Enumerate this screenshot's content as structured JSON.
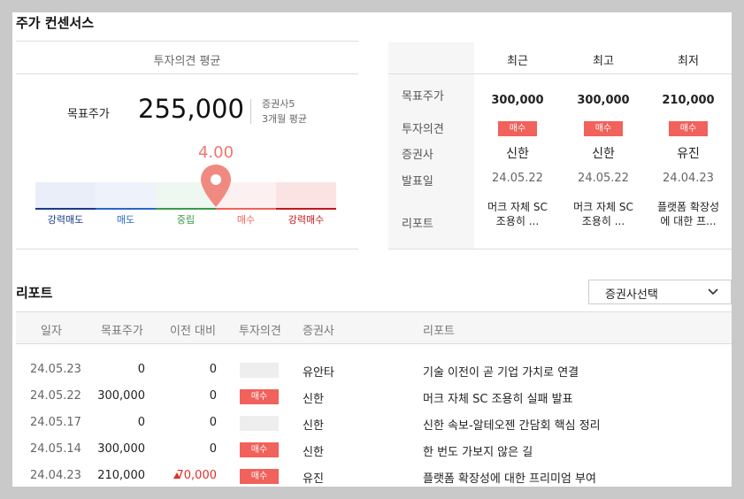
{
  "section_title": "주가 컨센서스",
  "consensus": {
    "header": "투자의견 평균",
    "target_label": "목표주가",
    "target_value": "255,000",
    "brokers_count": "증권사5",
    "period": "3개월 평균",
    "score": "4.00",
    "score_value": 4.0,
    "scale": [
      {
        "label": "강력매도",
        "color": "#1d3a8a",
        "bg": "#e9eef8"
      },
      {
        "label": "매도",
        "color": "#2a66c9",
        "bg": "#eef3fb"
      },
      {
        "label": "중립",
        "color": "#3a9a4a",
        "bg": "#eef7f0"
      },
      {
        "label": "매수",
        "color": "#f0625b",
        "bg": "#fdf0f0"
      },
      {
        "label": "강력매수",
        "color": "#c0191f",
        "bg": "#fbe3e4"
      }
    ],
    "pin_color": "#f08a80"
  },
  "compare": {
    "columns": [
      "최근",
      "최고",
      "최저"
    ],
    "row_labels": [
      "목표주가",
      "투자의견",
      "증권사",
      "발표일",
      "리포트"
    ],
    "data": [
      {
        "target": "300,000",
        "opinion": "매수",
        "broker": "신한",
        "date": "24.05.22",
        "report": [
          "머크 자체 SC",
          "조용히 ..."
        ]
      },
      {
        "target": "300,000",
        "opinion": "매수",
        "broker": "신한",
        "date": "24.05.22",
        "report": [
          "머크 자체 SC",
          "조용히 ..."
        ]
      },
      {
        "target": "210,000",
        "opinion": "매수",
        "broker": "유진",
        "date": "24.04.23",
        "report": [
          "플랫폼 확장성",
          "에 대한 프..."
        ]
      }
    ]
  },
  "reports": {
    "title": "리포트",
    "select_label": "증권사선택",
    "headers": [
      "일자",
      "목표주가",
      "이전 대비",
      "투자의견",
      "증권사",
      "리포트"
    ],
    "rows": [
      {
        "date": "24.05.23",
        "target": "0",
        "change": "0",
        "opinion": "",
        "broker": "유안타",
        "title": "기술 이전이 곧 기업 가치로 연결",
        "up": false
      },
      {
        "date": "24.05.22",
        "target": "300,000",
        "change": "0",
        "opinion": "매수",
        "broker": "신한",
        "title": "머크 자체 SC 조용히 실패 발표",
        "up": false
      },
      {
        "date": "24.05.17",
        "target": "0",
        "change": "0",
        "opinion": "",
        "broker": "신한",
        "title": "신한 속보-알테오젠 간담회 핵심 정리",
        "up": false
      },
      {
        "date": "24.05.14",
        "target": "300,000",
        "change": "0",
        "opinion": "매수",
        "broker": "신한",
        "title": "한 번도 가보지 않은 길",
        "up": false
      },
      {
        "date": "24.04.23",
        "target": "210,000",
        "change": "70,000",
        "opinion": "매수",
        "broker": "유진",
        "title": "플랫폼 확장성에 대한 프리미엄 부여",
        "up": true
      }
    ]
  }
}
